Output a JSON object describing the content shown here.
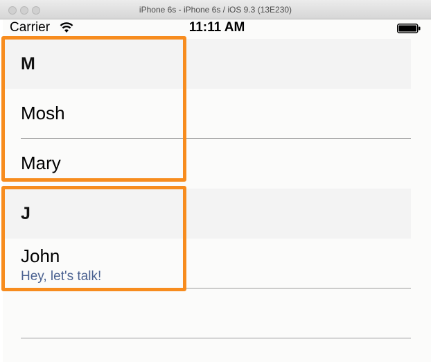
{
  "window": {
    "title": "iPhone 6s - iPhone 6s / iOS 9.3 (13E230)"
  },
  "statusbar": {
    "carrier": "Carrier",
    "time": "11:11 AM"
  },
  "sections": [
    {
      "letter": "M",
      "rows": [
        {
          "name": "Mosh"
        },
        {
          "name": "Mary"
        }
      ]
    },
    {
      "letter": "J",
      "rows": [
        {
          "name": "John",
          "subtitle": "Hey, let's talk!"
        }
      ]
    }
  ],
  "colors": {
    "highlight": "#f78c1e",
    "subtitle": "#4a6190",
    "section_header_bg": "#f3f3f3"
  }
}
